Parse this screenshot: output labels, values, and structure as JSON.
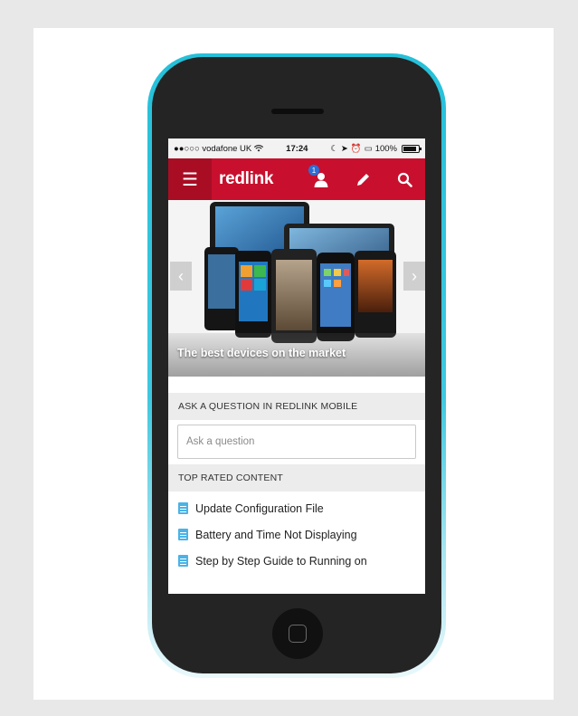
{
  "statusbar": {
    "carrier": "●●○○○ vodafone UK",
    "time": "17:24",
    "battery": "100%",
    "battery_level": 1.0
  },
  "appbar": {
    "menu_icon": "hamburger-icon",
    "logo": "redlink",
    "notification_count": "1",
    "icons": [
      "user-icon",
      "pencil-icon",
      "search-icon"
    ],
    "brand_color": "#c8102e"
  },
  "carousel": {
    "caption": "The best devices on the market",
    "prev_icon": "chevron-left-icon",
    "next_icon": "chevron-right-icon"
  },
  "ask": {
    "heading": "ASK A QUESTION IN REDLINK MOBILE",
    "placeholder": "Ask a question"
  },
  "top_rated": {
    "heading": "TOP RATED CONTENT",
    "items": [
      {
        "label": "Update Configuration File"
      },
      {
        "label": "Battery and Time Not Displaying"
      },
      {
        "label": "Step by Step Guide to Running on"
      }
    ]
  }
}
